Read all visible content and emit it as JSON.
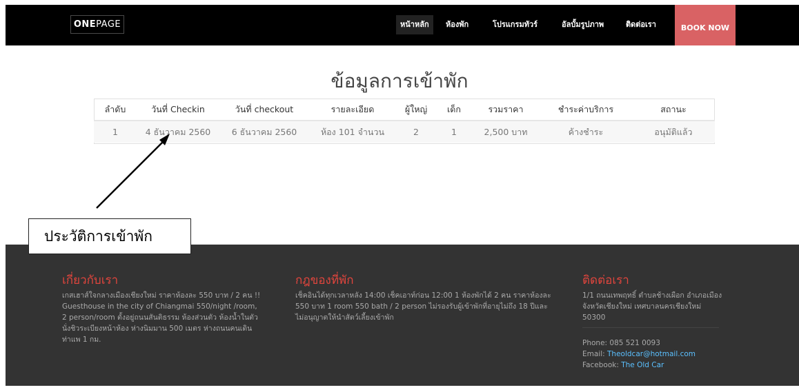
{
  "nav": {
    "brand_bold": "ONE",
    "brand_light": "PAGE",
    "items": [
      "หน้าหลัก",
      "ห้องพัก",
      "โปรแกรมทัวร์",
      "อัลบั้มรูปภาพ",
      "ติดต่อเรา"
    ],
    "book_label": "BOOK NOW"
  },
  "page_title": "ข้อมูลการเข้าพัก",
  "table": {
    "headers": [
      "ลำดับ",
      "วันที่ Checkin",
      "วันที่ checkout",
      "รายละเอียด",
      "ผู้ใหญ่",
      "เด็ก",
      "รวมราคา",
      "ชำระค่าบริการ",
      "สถานะ"
    ],
    "rows": [
      [
        "1",
        "4 ธันวาคม 2560",
        "6 ธันวาคม 2560",
        "ห้อง 101 จำนวน",
        "2",
        "1",
        "2,500 บาท",
        "ค้างชำระ",
        "อนุมัติแล้ว"
      ]
    ]
  },
  "annotation": "ประวัติการเข้าพัก",
  "footer": {
    "about": {
      "title": "เกี่ยวกับเรา",
      "text": "เกสเฮาส์ใจกลางเมืองเชียงใหม่ ราคาห้องละ 550 บาท / 2 คน !! Guesthouse in the city of Chiangmai 550/night /room, 2 person/room ตั้งอยู่ถนนสันติธรรม ห้องส่วนตัว ห้องน้ำในตัว นั่งชิวระเบียงหน้าห้อง ห่างนิมมาน 500 เมตร ห่างถนนคนเดินท่าแพ 1 กม."
    },
    "rules": {
      "title": "กฎของที่พัก",
      "text": "เช็คอินได้ทุกเวลาหลัง 14:00 เช็คเอาท์ก่อน 12:00 1 ห้องพักได้ 2 คน ราคาห้องละ 550 บาท 1 room 550 bath / 2 person ไม่รองรับผู้เข้าพักที่อายุไม่ถึง 18 ปีและ ไม่อนุญาตให้นำสัตว์เลี้ยงเข้าพัก"
    },
    "contact": {
      "title": "ติดต่อเรา",
      "address": "1/1 ถนนเทพฤทธิ์ ตำบลช้างเผือก อำเภอเมือง จังหวัดเชียงใหม่ เทศบาลนครเชียงใหม่ 50300",
      "phone": "Phone: 085 521 0093",
      "email_label": "Email: ",
      "email": "Theoldcar@hotmail.com",
      "facebook_label": "Facebook: ",
      "facebook": "The Old Car"
    }
  },
  "colors": {
    "accent": "#d96264",
    "footer_heading": "#e0453d",
    "link": "#5bc0ff"
  }
}
